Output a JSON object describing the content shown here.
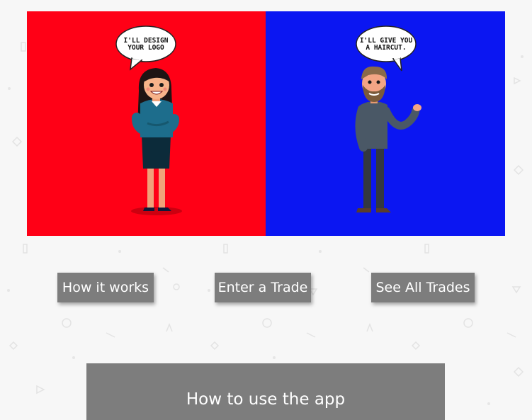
{
  "hero": {
    "left_panel": {
      "color": "#ff0016",
      "speech": "I'LL DESIGN\nYOUR LOGO"
    },
    "right_panel": {
      "color": "#0b16f2",
      "speech": "I'LL GIVE YOU\nA HAIRCUT."
    }
  },
  "nav": {
    "how_it_works": "How it works",
    "enter_trade": "Enter a Trade",
    "see_all_trades": "See All Trades"
  },
  "howto": {
    "title": "How to use the app"
  }
}
